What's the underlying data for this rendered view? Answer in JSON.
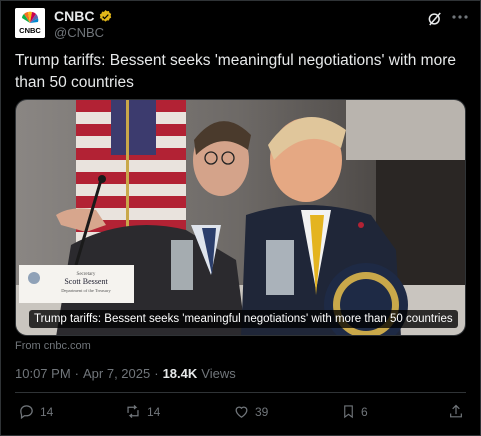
{
  "account": {
    "name": "CNBC",
    "handle": "@CNBC",
    "verified": true,
    "avatar_label": "CNBC"
  },
  "tweet": {
    "text": "Trump tariffs: Bessent seeks 'meaningful negotiations' with more than 50 countries"
  },
  "media": {
    "caption": "Trump tariffs: Bessent seeks 'meaningful negotiations' with more than 50 countries",
    "nameplate_small": "Secretary",
    "nameplate_name": "Scott Bessent",
    "nameplate_dept": "Department of the Treasury"
  },
  "source": "From cnbc.com",
  "meta": {
    "time": "10:07 PM",
    "separator": "·",
    "date": "Apr 7, 2025",
    "views_count": "18.4K",
    "views_label": "Views"
  },
  "actions": {
    "replies": "14",
    "reposts": "14",
    "likes": "39",
    "bookmarks": "6"
  },
  "colors": {
    "background": "#000000",
    "text": "#e7e9ea",
    "muted": "#71767b",
    "verified_badge": "#e2b719"
  },
  "icons": [
    "cnbc-logo",
    "verified-badge-icon",
    "grok-icon",
    "more-icon",
    "reply-icon",
    "repost-icon",
    "like-icon",
    "bookmark-icon",
    "share-icon"
  ]
}
